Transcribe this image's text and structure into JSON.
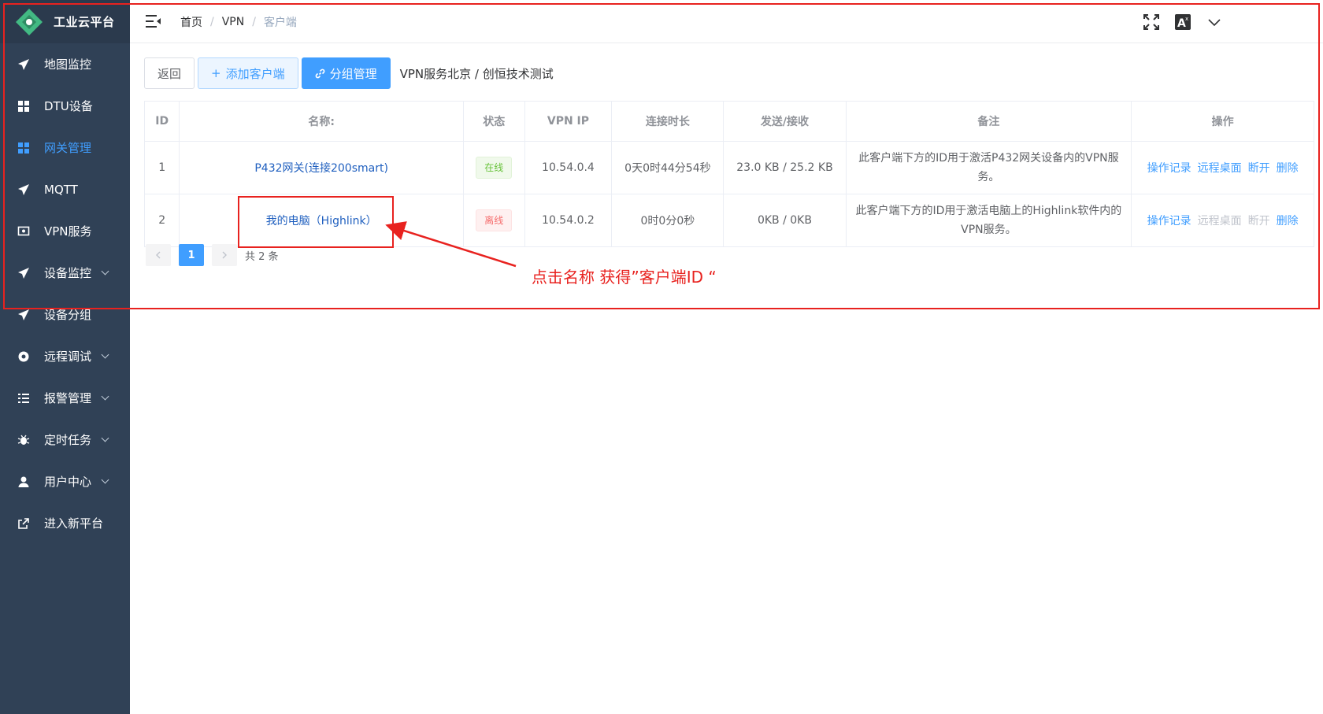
{
  "app": {
    "title": "工业云平台"
  },
  "sidebar": {
    "items": [
      {
        "label": "地图监控",
        "icon": "send-icon"
      },
      {
        "label": "DTU设备",
        "icon": "grid-icon"
      },
      {
        "label": "网关管理",
        "icon": "grid-icon",
        "active": true
      },
      {
        "label": "MQTT",
        "icon": "send-icon"
      },
      {
        "label": "VPN服务",
        "icon": "monitor-icon"
      },
      {
        "label": "设备监控",
        "icon": "send-icon",
        "expandable": true
      },
      {
        "label": "设备分组",
        "icon": "send-icon"
      },
      {
        "label": "远程调试",
        "icon": "gear-icon",
        "expandable": true
      },
      {
        "label": "报警管理",
        "icon": "list-icon",
        "expandable": true
      },
      {
        "label": "定时任务",
        "icon": "bug-icon",
        "expandable": true
      },
      {
        "label": "用户中心",
        "icon": "user-icon",
        "expandable": true
      },
      {
        "label": "进入新平台",
        "icon": "external-link-icon"
      }
    ]
  },
  "header": {
    "breadcrumb": [
      "首页",
      "VPN",
      "客户端"
    ]
  },
  "toolbar": {
    "back_label": "返回",
    "add_label": "添加客户端",
    "group_label": "分组管理",
    "vpn_path": "VPN服务北京 / 创恒技术测试"
  },
  "table": {
    "columns": [
      "ID",
      "名称:",
      "状态",
      "VPN IP",
      "连接时长",
      "发送/接收",
      "备注",
      "操作"
    ],
    "rows": [
      {
        "id": "1",
        "name": "P432网关(连接200smart)",
        "status": "在线",
        "status_type": "online",
        "vpn_ip": "10.54.0.4",
        "duration": "0天0时44分54秒",
        "traffic": "23.0 KB / 25.2 KB",
        "remark": "此客户端下方的ID用于激活P432网关设备内的VPN服务。",
        "ops": [
          {
            "label": "操作记录",
            "enabled": true
          },
          {
            "label": "远程桌面",
            "enabled": true
          },
          {
            "label": "断开",
            "enabled": true
          },
          {
            "label": "删除",
            "enabled": true
          }
        ]
      },
      {
        "id": "2",
        "name": "我的电脑（Highlink）",
        "status": "离线",
        "status_type": "offline",
        "vpn_ip": "10.54.0.2",
        "duration": "0时0分0秒",
        "traffic": "0KB / 0KB",
        "remark": "此客户端下方的ID用于激活电脑上的Highlink软件内的VPN服务。",
        "ops": [
          {
            "label": "操作记录",
            "enabled": true
          },
          {
            "label": "远程桌面",
            "enabled": false
          },
          {
            "label": "断开",
            "enabled": false
          },
          {
            "label": "删除",
            "enabled": true
          }
        ]
      }
    ]
  },
  "pagination": {
    "current_page": "1",
    "total_text": "共 2 条"
  },
  "annotation": {
    "text": "点击名称 获得”客户端ID “",
    "color": "#e8221f"
  },
  "colors": {
    "sidebar_bg": "#304156",
    "accent": "#409eff",
    "online": "#67c23a",
    "offline": "#f56c6c"
  }
}
